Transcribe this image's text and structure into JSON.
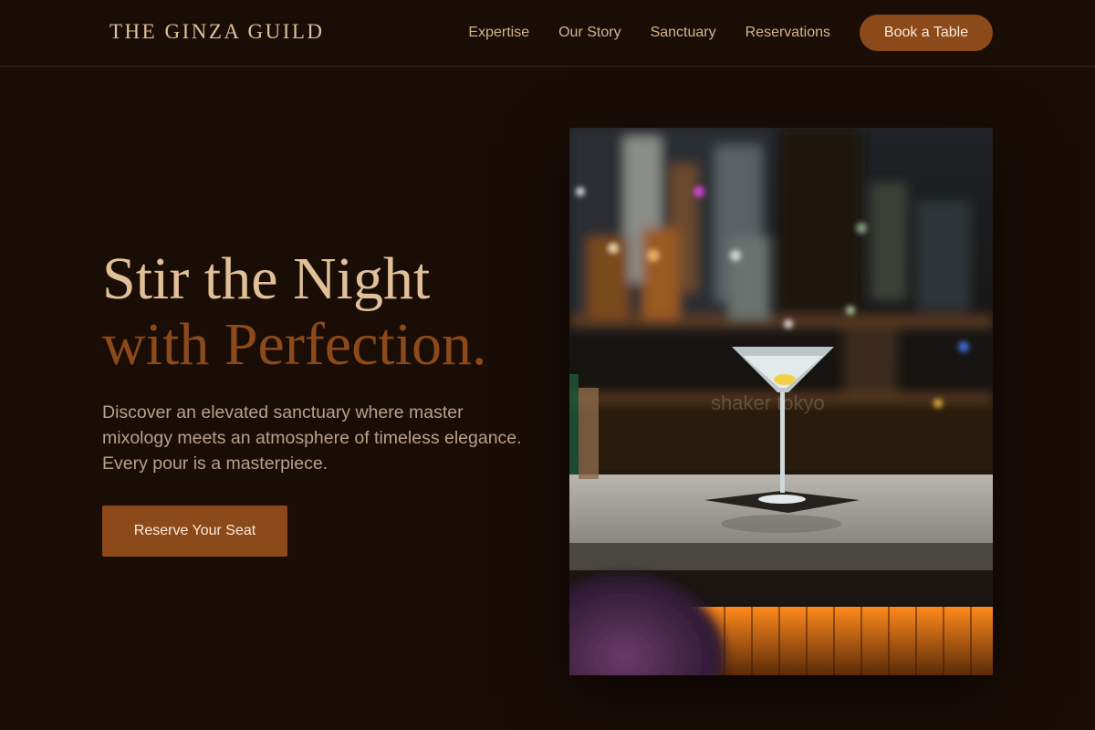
{
  "nav": {
    "brand": "THE GINZA GUILD",
    "links": [
      "Expertise",
      "Our Story",
      "Sanctuary",
      "Reservations"
    ],
    "cta": "Book a Table"
  },
  "hero": {
    "title_line1": "Stir the Night",
    "title_line2": "with Perfection.",
    "description": "Discover an elevated sanctuary where master mixology meets an atmosphere of timeless elegance. Every pour is a masterpiece.",
    "cta": "Reserve Your Seat"
  },
  "photo": {
    "subject": "martini glass on marble bar counter with blurred bottle shelves",
    "watermark": "shaker tokyo"
  },
  "colors": {
    "background": "#1a0d06",
    "accent": "#8c4a1a",
    "title": "#dfc099",
    "text_muted": "#b9a089"
  }
}
